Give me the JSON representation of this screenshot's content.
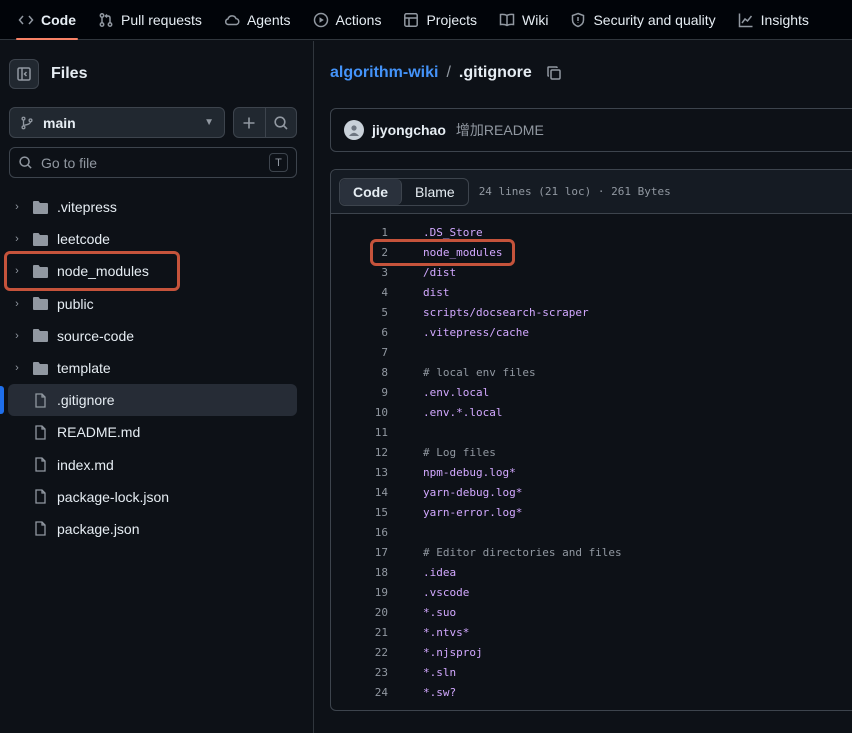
{
  "nav": {
    "items": [
      {
        "label": "Code",
        "icon": "code-icon",
        "active": true
      },
      {
        "label": "Pull requests",
        "icon": "pull-request-icon"
      },
      {
        "label": "Agents",
        "icon": "agents-icon"
      },
      {
        "label": "Actions",
        "icon": "play-icon"
      },
      {
        "label": "Projects",
        "icon": "table-icon"
      },
      {
        "label": "Wiki",
        "icon": "book-icon"
      },
      {
        "label": "Security and quality",
        "icon": "shield-icon"
      },
      {
        "label": "Insights",
        "icon": "graph-icon"
      }
    ]
  },
  "sidebar": {
    "title": "Files",
    "branch": "main",
    "search_placeholder": "Go to file",
    "search_shortcut": "T",
    "tree": [
      {
        "label": ".vitepress",
        "type": "folder"
      },
      {
        "label": "leetcode",
        "type": "folder"
      },
      {
        "label": "node_modules",
        "type": "folder",
        "highlighted": true
      },
      {
        "label": "public",
        "type": "folder"
      },
      {
        "label": "source-code",
        "type": "folder"
      },
      {
        "label": "template",
        "type": "folder"
      },
      {
        "label": ".gitignore",
        "type": "file",
        "selected": true
      },
      {
        "label": "README.md",
        "type": "file"
      },
      {
        "label": "index.md",
        "type": "file"
      },
      {
        "label": "package-lock.json",
        "type": "file"
      },
      {
        "label": "package.json",
        "type": "file"
      }
    ]
  },
  "breadcrumb": {
    "repo": "algorithm-wiki",
    "separator": "/",
    "file": ".gitignore"
  },
  "commit": {
    "author": "jiyongchao",
    "message": "增加README"
  },
  "code": {
    "tabs": {
      "code": "Code",
      "blame": "Blame"
    },
    "meta": "24 lines (21 loc) · 261 Bytes",
    "lines": [
      {
        "n": "1",
        "t": ".DS_Store"
      },
      {
        "n": "2",
        "t": "node_modules",
        "highlighted": true
      },
      {
        "n": "3",
        "t": "/dist"
      },
      {
        "n": "4",
        "t": "dist"
      },
      {
        "n": "5",
        "t": "scripts/docsearch-scraper"
      },
      {
        "n": "6",
        "t": ".vitepress/cache"
      },
      {
        "n": "7",
        "t": ""
      },
      {
        "n": "8",
        "t": "# local env files",
        "comment": true
      },
      {
        "n": "9",
        "t": ".env.local"
      },
      {
        "n": "10",
        "t": ".env.*.local"
      },
      {
        "n": "11",
        "t": ""
      },
      {
        "n": "12",
        "t": "# Log files",
        "comment": true
      },
      {
        "n": "13",
        "t": "npm-debug.log*"
      },
      {
        "n": "14",
        "t": "yarn-debug.log*"
      },
      {
        "n": "15",
        "t": "yarn-error.log*"
      },
      {
        "n": "16",
        "t": ""
      },
      {
        "n": "17",
        "t": "# Editor directories and files",
        "comment": true
      },
      {
        "n": "18",
        "t": ".idea"
      },
      {
        "n": "19",
        "t": ".vscode"
      },
      {
        "n": "20",
        "t": "*.suo"
      },
      {
        "n": "21",
        "t": "*.ntvs*"
      },
      {
        "n": "22",
        "t": "*.njsproj"
      },
      {
        "n": "23",
        "t": "*.sln"
      },
      {
        "n": "24",
        "t": "*.sw?"
      }
    ]
  },
  "colors": {
    "accent": "#4493f8",
    "highlight": "#c5533b",
    "nav_underline": "#f78166"
  }
}
